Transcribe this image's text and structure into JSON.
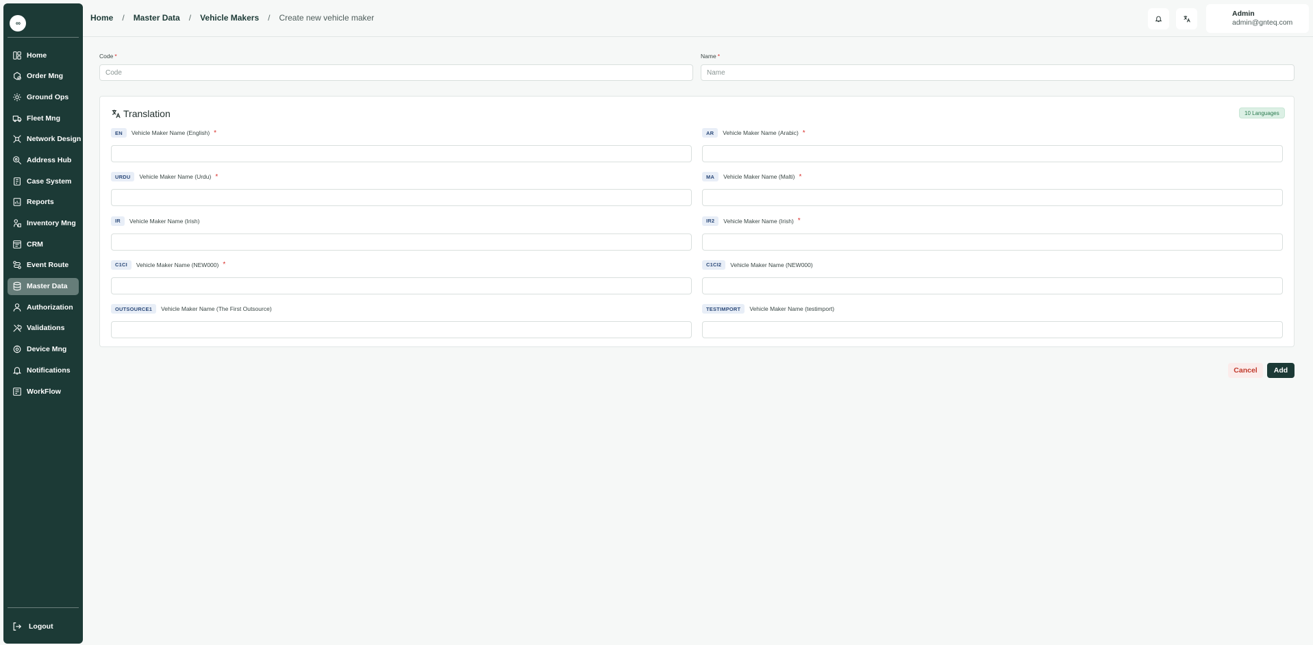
{
  "sidebar": {
    "logo_glyph": "∞",
    "items": [
      {
        "label": "Home",
        "icon": "layout-icon",
        "active": false
      },
      {
        "label": "Order Mng",
        "icon": "package-icon",
        "active": false
      },
      {
        "label": "Ground Ops",
        "icon": "sun-icon",
        "active": false
      },
      {
        "label": "Fleet Mng",
        "icon": "truck-icon",
        "active": false
      },
      {
        "label": "Network Design",
        "icon": "network-icon",
        "active": false
      },
      {
        "label": "Address Hub",
        "icon": "map-pin-icon",
        "active": false
      },
      {
        "label": "Case System",
        "icon": "briefcase-icon",
        "active": false
      },
      {
        "label": "Reports",
        "icon": "report-icon",
        "active": false
      },
      {
        "label": "Inventory Mng",
        "icon": "inventory-icon",
        "active": false
      },
      {
        "label": "CRM",
        "icon": "crm-icon",
        "active": false
      },
      {
        "label": "Event Route",
        "icon": "route-icon",
        "active": false
      },
      {
        "label": "Master Data",
        "icon": "database-icon",
        "active": true
      },
      {
        "label": "Authorization",
        "icon": "user-icon",
        "active": false
      },
      {
        "label": "Validations",
        "icon": "tools-icon",
        "active": false
      },
      {
        "label": "Device Mng",
        "icon": "device-icon",
        "active": false
      },
      {
        "label": "Notifications",
        "icon": "bell-icon",
        "active": false
      },
      {
        "label": "WorkFlow",
        "icon": "workflow-icon",
        "active": false
      }
    ],
    "logout_label": "Logout"
  },
  "header": {
    "breadcrumb": [
      "Home",
      "Master Data",
      "Vehicle Makers"
    ],
    "breadcrumb_separator": "/",
    "breadcrumb_current": "Create new vehicle maker",
    "user_name": "Admin",
    "user_email": "admin@gnteq.com"
  },
  "form": {
    "code": {
      "label": "Code",
      "required_mark": "*",
      "placeholder": "Code",
      "value": ""
    },
    "name": {
      "label": "Name",
      "required_mark": "*",
      "placeholder": "Name",
      "value": ""
    }
  },
  "translation": {
    "title": "Translation",
    "languages_badge": "10 Languages",
    "fields": [
      {
        "code": "EN",
        "label": "Vehicle Maker Name (English)",
        "required": true
      },
      {
        "code": "AR",
        "label": "Vehicle Maker Name (Arabic)",
        "required": true
      },
      {
        "code": "URDU",
        "label": "Vehicle Maker Name (Urdu)",
        "required": true
      },
      {
        "code": "MA",
        "label": "Vehicle Maker Name (Malti)",
        "required": true
      },
      {
        "code": "IR",
        "label": "Vehicle Maker Name (Irish)",
        "required": false
      },
      {
        "code": "IR2",
        "label": "Vehicle Maker Name (Irish)",
        "required": true
      },
      {
        "code": "C1CI",
        "label": "Vehicle Maker Name (NEW000)",
        "required": true
      },
      {
        "code": "C1CI2",
        "label": "Vehicle Maker Name (NEW000)",
        "required": false
      },
      {
        "code": "OUTSOURCE1",
        "label": "Vehicle Maker Name (The First Outsource)",
        "required": false
      },
      {
        "code": "TESTIMPORT",
        "label": "Vehicle Maker Name (testimport)",
        "required": false
      }
    ],
    "required_mark": "*"
  },
  "actions": {
    "cancel_label": "Cancel",
    "add_label": "Add"
  },
  "colors": {
    "sidebar_bg": "#1c3a36",
    "active_item": "#667d79",
    "primary": "#1c3a36",
    "danger": "#c0392b",
    "required": "#d9302c"
  }
}
